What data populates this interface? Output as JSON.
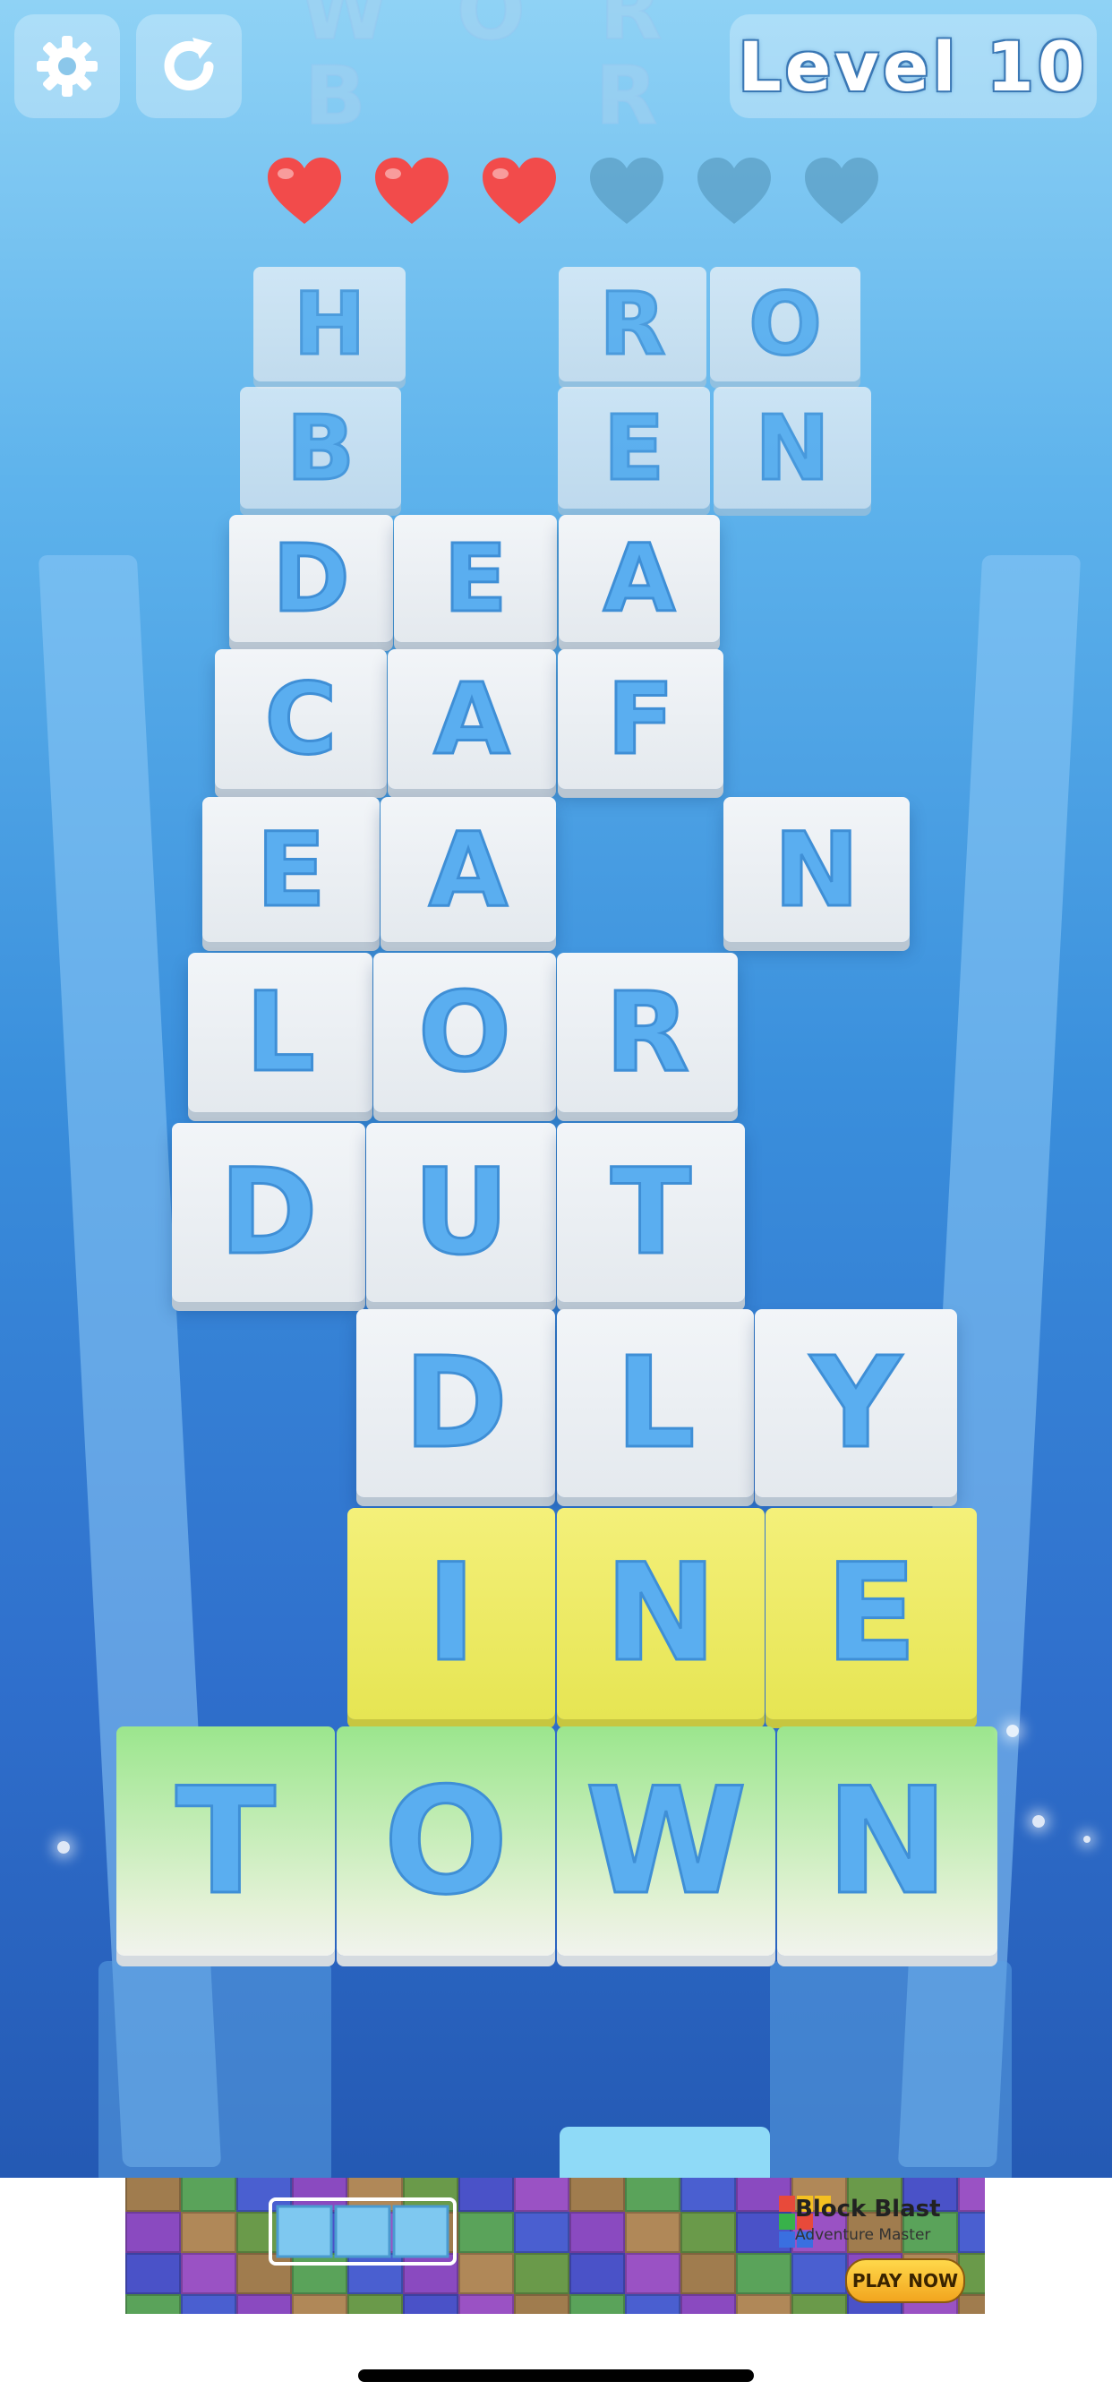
{
  "header": {
    "level_label": "Level 10",
    "settings_icon": "gear-icon",
    "restart_icon": "restart-icon"
  },
  "lives": {
    "total": 6,
    "remaining": 3,
    "full_color": "#f24b4b",
    "empty_color": "#4f8fb5"
  },
  "ghost_letters": [
    "W",
    "O",
    "R",
    "B",
    "R"
  ],
  "board": {
    "faded_tiles": [
      "H",
      "R",
      "O",
      "B",
      "E",
      "N"
    ],
    "rows": [
      [
        "D",
        "E",
        "A"
      ],
      [
        "C",
        "A",
        "F"
      ],
      [
        "E",
        "A",
        "N"
      ],
      [
        "L",
        "O",
        "R"
      ],
      [
        "D",
        "U",
        "T"
      ],
      [
        "D",
        "L",
        "Y"
      ]
    ],
    "yellow_row": [
      "I",
      "N",
      "E"
    ],
    "green_row": [
      "T",
      "O",
      "W",
      "N"
    ]
  },
  "ad": {
    "title": "Block Blast",
    "subtitle": "Adventure Master",
    "cta": "PLAY NOW"
  },
  "colors": {
    "letter": "#5aaef0",
    "tile": "#eef2f6",
    "highlight_yellow": "#ecea62",
    "highlight_green": "#9be68d"
  }
}
